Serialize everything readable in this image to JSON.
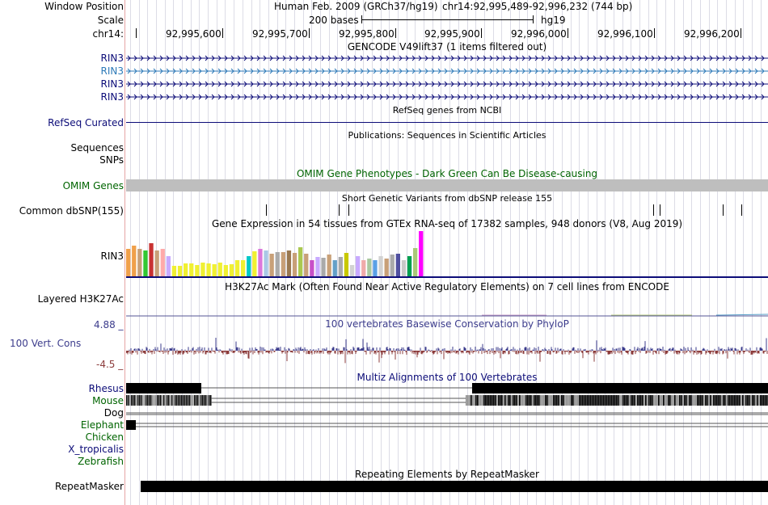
{
  "browser": {
    "window_position_label": "Window Position",
    "assembly": "Human Feb. 2009 (GRCh37/hg19)",
    "position": "chr14:92,995,489-92,996,232 (744 bp)",
    "scale_label": "Scale",
    "scale_value": "200 bases",
    "db": "hg19",
    "chrom_label": "chr14:",
    "ruler_ticks": [
      "92,995,600",
      "92,995,700",
      "92,995,800",
      "92,995,900",
      "92,996,000",
      "92,996,100",
      "92,996,200"
    ]
  },
  "colors": {
    "gencode": "#0c0c78",
    "gencode_alt": "#2e7ab8",
    "refseq": "#0c0c78",
    "omim_label": "#006400",
    "omim_bar": "#bebebe",
    "phylop_pos": "#3c3c8c",
    "phylop_neg": "#8c3c3c",
    "rhesus": "#0c0c78",
    "mouse": "#006400",
    "grid": "#dcdce6"
  },
  "tracks": {
    "gencode": {
      "title": "GENCODE V49lift37 (1 items filtered out)",
      "transcripts": [
        "RIN3",
        "RIN3",
        "RIN3",
        "RIN3"
      ]
    },
    "refseq": {
      "title": "RefSeq genes from NCBI",
      "label": "RefSeq Curated"
    },
    "publications": {
      "title": "Publications: Sequences in Scientific Articles",
      "label_sequences": "Sequences",
      "label_snps": "SNPs"
    },
    "omim": {
      "title": "OMIM Gene Phenotypes - Dark Green Can Be Disease-causing",
      "label": "OMIM Genes"
    },
    "dbsnp": {
      "title": "Short Genetic Variants from dbSNP release 155",
      "label": "Common dbSNP(155)"
    },
    "gtex": {
      "title": "Gene Expression in 54 tissues from GTEx RNA-seq of 17382 samples, 948 donors (V8, Aug 2019)",
      "label": "RIN3",
      "values": [
        34,
        38,
        34,
        32,
        41,
        32,
        34,
        25,
        13,
        13,
        16,
        16,
        14,
        17,
        16,
        15,
        17,
        14,
        15,
        20,
        20,
        25,
        31,
        34,
        32,
        28,
        30,
        30,
        32,
        29,
        36,
        28,
        20,
        24,
        23,
        27,
        20,
        24,
        29,
        14,
        25,
        20,
        22,
        20,
        25,
        22,
        27,
        28,
        20,
        25,
        35,
        56
      ],
      "bar_colors": [
        "#f0a04b",
        "#f0a04b",
        "#c8a078",
        "#32c832",
        "#c83232",
        "#c8a078",
        "#ffaaaa",
        "#c8aaff",
        "#f0f032",
        "#f0f032",
        "#f0f032",
        "#f0f032",
        "#f0f032",
        "#f0f032",
        "#f0f032",
        "#f0f032",
        "#f0f032",
        "#f0f032",
        "#f0f032",
        "#f0f032",
        "#f0f032",
        "#00c8c8",
        "#f0f032",
        "#dc78dc",
        "#aac8e6",
        "#c8a078",
        "#aaaaaa",
        "#c8a078",
        "#9a7850",
        "#c8a078",
        "#aac850",
        "#c8a078",
        "#c850c8",
        "#c8aaff",
        "#aaaaaa",
        "#c8a078",
        "#64a0c8",
        "#aaaaaa",
        "#c8c800",
        "#d2d2d2",
        "#c8aaff",
        "#f0aaaa",
        "#aac8a0",
        "#5aa0e6",
        "#d2d2d2",
        "#c8a078",
        "#aaaaaa",
        "#5050a0",
        "#c8c8c8",
        "#00a050",
        "#aac878",
        "#ff00ff"
      ]
    },
    "h3k27ac": {
      "title": "H3K27Ac Mark (Often Found Near Active Regulatory Elements) on 7 cell lines from ENCODE",
      "label": "Layered H3K27Ac"
    },
    "phylop": {
      "title": "100 vertebrates Basewise Conservation by PhyloP",
      "label": "100 Vert. Cons",
      "max_label": "4.88 _",
      "min_label": "-4.5 _"
    },
    "multiz": {
      "title": "Multiz Alignments of 100 Vertebrates",
      "species": [
        "Rhesus",
        "Mouse",
        "Dog",
        "Elephant",
        "Chicken",
        "X_tropicalis",
        "Zebrafish"
      ]
    },
    "repeatmasker": {
      "title": "Repeating Elements by RepeatMasker",
      "label": "RepeatMasker"
    }
  }
}
